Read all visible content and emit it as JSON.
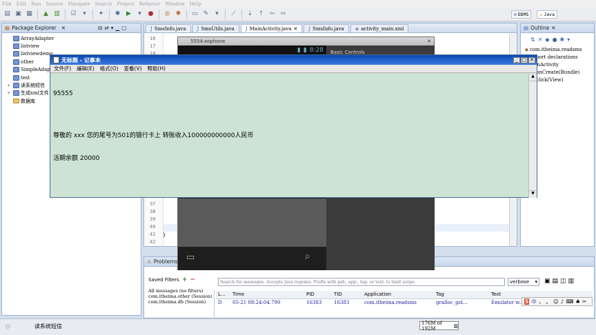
{
  "menu": [
    "File",
    "Edit",
    "Run",
    "Source",
    "Navigate",
    "Search",
    "Project",
    "Refactor",
    "Window",
    "Help"
  ],
  "perspectives": [
    {
      "label": "DDMS",
      "active": false
    },
    {
      "label": "Java",
      "active": true
    }
  ],
  "package_explorer": {
    "title": "Package Explorer",
    "items": [
      {
        "label": "ArrayAdapter",
        "kind": "project",
        "expander": ""
      },
      {
        "label": "listview",
        "kind": "project",
        "expander": ""
      },
      {
        "label": "listviewdemo",
        "kind": "project",
        "expander": ""
      },
      {
        "label": "other",
        "kind": "project",
        "expander": ""
      },
      {
        "label": "SimpleAdapter",
        "kind": "project",
        "expander": ""
      },
      {
        "label": "test",
        "kind": "project",
        "expander": ""
      },
      {
        "label": "读系统短信",
        "kind": "project",
        "expander": "+"
      },
      {
        "label": "生成xml文件",
        "kind": "project",
        "expander": "+"
      },
      {
        "label": "数据库",
        "kind": "folder",
        "expander": ""
      }
    ]
  },
  "editor": {
    "tabs": [
      {
        "label": "SmsInfo.java",
        "active": false
      },
      {
        "label": "SmsUtils.java",
        "active": false
      },
      {
        "label": "MainActivity.java",
        "active": true
      },
      {
        "label": "SmsInfo.java",
        "active": false
      },
      {
        "label": "activity_main.xml",
        "active": false
      }
    ],
    "lines_top": [
      "16",
      "17",
      "18"
    ],
    "lines_bottom": [
      "37",
      "38",
      "39",
      "40",
      "41",
      "42"
    ],
    "code_bottom": "}"
  },
  "emulator": {
    "title": "5554:xophone",
    "time": "8:28",
    "app_title": "Basic Controls"
  },
  "notepad": {
    "title": "无标题 - 记事本",
    "menu": [
      "文件(F)",
      "编辑(E)",
      "格式(O)",
      "查看(V)",
      "帮助(H)"
    ],
    "line1": "95555",
    "line2": "尊敬的 xxx 您的尾号为501的银行卡上 转账收入100000000000人民币",
    "line3": "活期余额 20000"
  },
  "outline": {
    "title": "Outline",
    "items": [
      {
        "label": "com.itheima.readsms",
        "indent": 6
      },
      {
        "label": "import declarations",
        "indent": 6
      },
      {
        "label": "MainActivity",
        "indent": 2
      },
      {
        "label": "onCreate(Bundle)",
        "indent": 14
      },
      {
        "label": "click(View)",
        "indent": 14
      }
    ]
  },
  "bottom": {
    "tab_label": "Problems",
    "saved_filters": "Saved Filters",
    "filter_items": [
      "All messages (no filters)",
      "com.itheima.other (Session)",
      "com.itheima.db (Session)"
    ],
    "search_placeholder": "Search for messages. Accepts Java regexes. Prefix with pid:, app:, tag: or text: to limit scope.",
    "level": "verbose",
    "columns": [
      "L...",
      "Time",
      "PID",
      "TID",
      "Application",
      "Tag",
      "Text"
    ],
    "row": [
      "D",
      "05-21 08:24:04.790",
      "16383",
      "16383",
      "com.itheima.readsms",
      "gralloc_gol...",
      "Emulator w..."
    ]
  },
  "status": {
    "left_text": "读系统短信",
    "heap": "176M of 192M"
  },
  "ime": [
    "中",
    "，",
    "。"
  ]
}
